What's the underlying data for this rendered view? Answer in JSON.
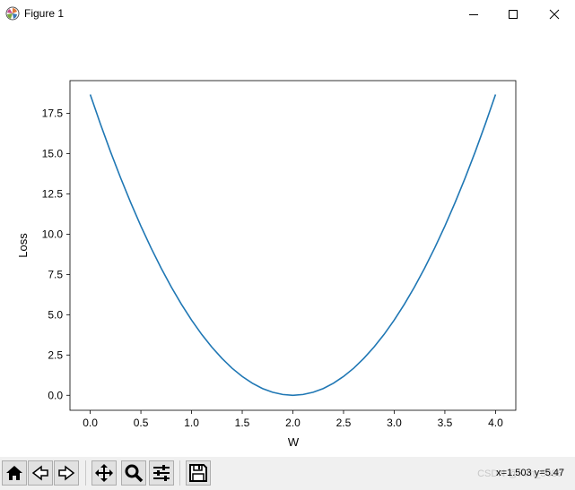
{
  "window": {
    "title": "Figure 1",
    "controls": {
      "minimize": "—",
      "maximize": "☐",
      "close": "✕"
    }
  },
  "chart_data": {
    "type": "line",
    "title": "",
    "xlabel": "W",
    "ylabel": "Loss",
    "xlim": [
      -0.2,
      4.2
    ],
    "ylim": [
      -0.93,
      19.53
    ],
    "x_ticks": [
      "0.0",
      "0.5",
      "1.0",
      "1.5",
      "2.0",
      "2.5",
      "3.0",
      "3.5",
      "4.0"
    ],
    "y_ticks": [
      "0.0",
      "2.5",
      "5.0",
      "7.5",
      "10.0",
      "12.5",
      "15.0",
      "17.5"
    ],
    "series": [
      {
        "color": "#1f77b4",
        "x": [
          0.0,
          0.1,
          0.2,
          0.3,
          0.4,
          0.5,
          0.6,
          0.7,
          0.8,
          0.9,
          1.0,
          1.1,
          1.2,
          1.3,
          1.4,
          1.5,
          1.6,
          1.7,
          1.8,
          1.9,
          2.0,
          2.1,
          2.2,
          2.3,
          2.4,
          2.5,
          2.6,
          2.7,
          2.8,
          2.9,
          3.0,
          3.1,
          3.2,
          3.3,
          3.4,
          3.5,
          3.6,
          3.7,
          3.8,
          3.9,
          4.0
        ],
        "y": [
          18.67,
          16.85,
          15.12,
          13.49,
          11.95,
          10.5,
          9.15,
          7.89,
          6.72,
          5.65,
          4.67,
          3.78,
          2.99,
          2.29,
          1.68,
          1.17,
          0.75,
          0.42,
          0.19,
          0.05,
          0.0,
          0.05,
          0.19,
          0.42,
          0.75,
          1.17,
          1.68,
          2.29,
          2.99,
          3.78,
          4.67,
          5.65,
          6.72,
          7.89,
          9.15,
          10.5,
          11.95,
          13.49,
          15.12,
          16.85,
          18.67
        ]
      }
    ],
    "grid": false
  },
  "toolbar": {
    "home": "home-icon",
    "back": "back-arrow-icon",
    "forward": "forward-arrow-icon",
    "pan": "pan-icon",
    "zoom": "zoom-icon",
    "configure": "configure-subplots-icon",
    "save": "save-icon",
    "coordinates": "x=1.503 y=5.47",
    "watermark": "CSDN @Kim_5086"
  }
}
